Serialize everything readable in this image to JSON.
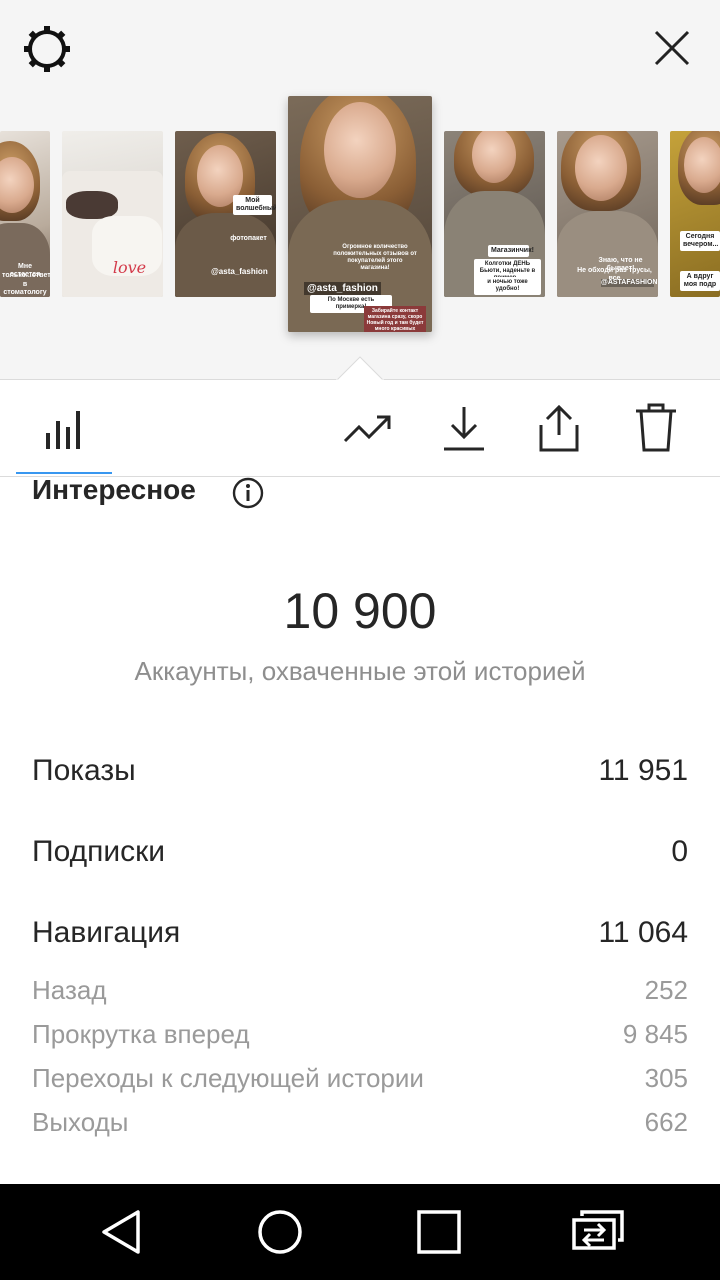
{
  "header": {
    "settings_icon": "gear-icon",
    "close_icon": "close-icon"
  },
  "stories": [
    {
      "captions": [
        "Мне остается",
        "только...ответить",
        "в стоматологу"
      ]
    },
    {
      "captions": [
        "love"
      ]
    },
    {
      "captions": [
        "Мой волшебный",
        "фотопакет",
        "@asta_fashion"
      ]
    },
    {
      "captions": [
        "Огромное количество положительных отзывов от покупателей этого магазина!",
        "@asta_fashion",
        "По Москве есть примерка!",
        "Забирайте контакт магазина сразу, скоро Новый год и там будет много красивых"
      ]
    },
    {
      "captions": [
        "Магазинчик!",
        "Колготки ДЕНЬ Бьюти, наденьте в пример...",
        "и ночью тоже удобно!"
      ]
    },
    {
      "captions": [
        "Знаю, что не бывает!",
        "Не обходи раз трусы, все",
        "@ASTAFASHION"
      ]
    },
    {
      "captions": [
        "Сегодня вечером...",
        "А вдруг моя подр"
      ]
    }
  ],
  "tabs": {
    "insights_icon": "bar-chart-icon",
    "promote_icon": "trending-up-icon",
    "download_icon": "download-icon",
    "share_icon": "share-icon",
    "delete_icon": "trash-icon"
  },
  "section": {
    "title": "Интересное",
    "info_icon": "info-icon"
  },
  "reach": {
    "value": "10 900",
    "caption": "Аккаунты, охваченные этой историей"
  },
  "metrics": [
    {
      "label": "Показы",
      "value": "11 951"
    },
    {
      "label": "Подписки",
      "value": "0"
    },
    {
      "label": "Навигация",
      "value": "11 064"
    }
  ],
  "navigation_details": [
    {
      "label": "Назад",
      "value": "252"
    },
    {
      "label": "Прокрутка вперед",
      "value": "9 845"
    },
    {
      "label": "Переходы к следующей истории",
      "value": "305"
    },
    {
      "label": "Выходы",
      "value": "662"
    }
  ],
  "system_nav": {
    "back_icon": "back-triangle-icon",
    "home_icon": "home-circle-icon",
    "recents_icon": "recents-square-icon",
    "switch_icon": "switch-app-icon"
  },
  "colors": {
    "accent": "#3897f0",
    "text_primary": "#262626",
    "text_secondary": "#8e8e8e"
  }
}
